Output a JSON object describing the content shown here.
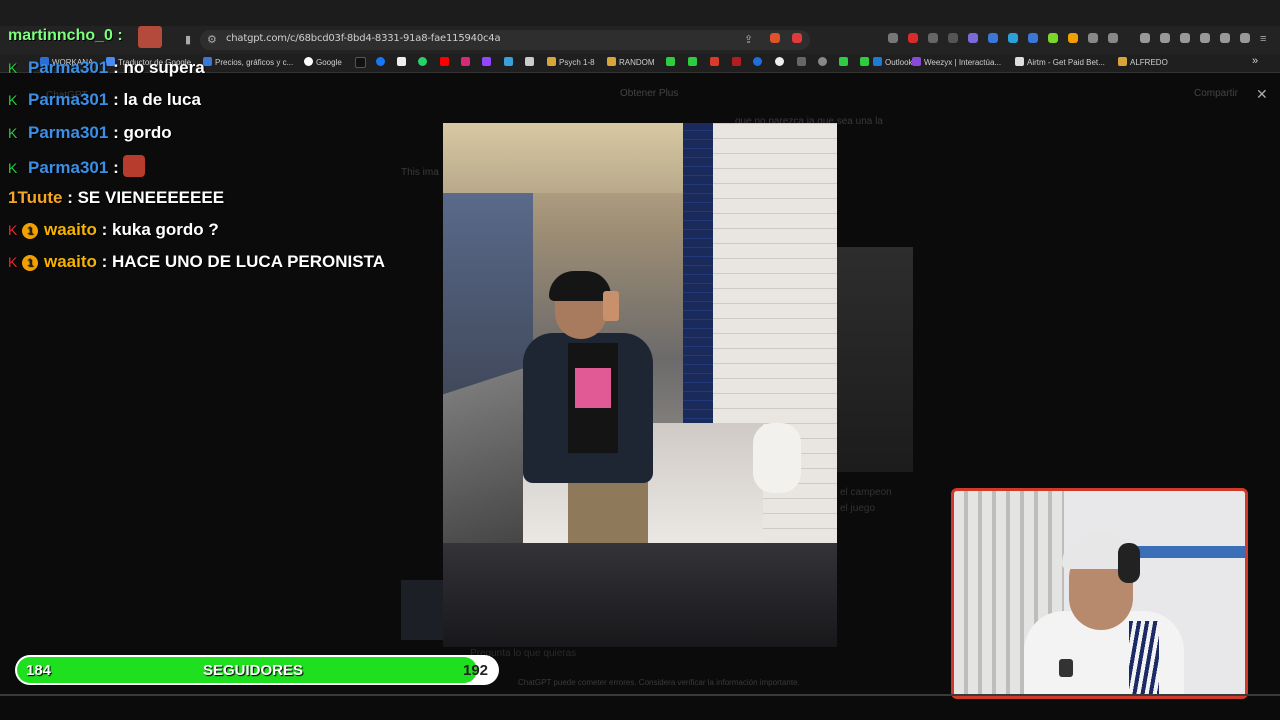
{
  "browser": {
    "url": "chatgpt.com/c/68bcd03f-8bd4-8331-91a8-fae115940c4a",
    "bookmarks": [
      {
        "label": "WORKANA",
        "color": "#2a6fd6"
      },
      {
        "label": "Traductor de Google",
        "color": "#4a8af4"
      },
      {
        "label": "Precios, gráficos y c...",
        "color": "#3a77d8"
      },
      {
        "label": "Google",
        "color": "#ffffff"
      },
      {
        "label": "Psych 1-8",
        "color": "#d9a53a"
      },
      {
        "label": "RANDOM",
        "color": "#d9a53a"
      },
      {
        "label": "Outlook",
        "color": "#1d7bd6"
      },
      {
        "label": "Weezyx | Interactúa...",
        "color": "#8a4ad9"
      },
      {
        "label": "Airtm - Get Paid Bet...",
        "color": "#dddddd"
      },
      {
        "label": "ALFREDO",
        "color": "#d9a53a"
      }
    ]
  },
  "chatgpt_ghost": {
    "title": "ChatGPT",
    "upgrade": "Obtener Plus",
    "share": "Compartir",
    "snippet_right": "que no parezca ia que sea una la",
    "snippet_left": "This ima",
    "snippet_mid": "el campeon",
    "snippet_mid2": "el juego",
    "input_placeholder": "Pregunta lo que quieras",
    "disclaimer": "ChatGPT puede cometer errores. Considera verificar la información importante."
  },
  "chat": {
    "streamer_name": "martinncho_0 :",
    "messages": [
      {
        "user": "Parma301",
        "text": ": no supera",
        "user_color": "blue",
        "badge": "K",
        "emote": false
      },
      {
        "user": "Parma301",
        "text": ": la de luca",
        "user_color": "blue",
        "badge": "K",
        "emote": false
      },
      {
        "user": "Parma301",
        "text": ": gordo",
        "user_color": "blue",
        "badge": "K",
        "emote": false
      },
      {
        "user": "Parma301",
        "text": ":",
        "user_color": "blue",
        "badge": "K",
        "emote": true
      },
      {
        "user": "1Tuute",
        "text": ": SE VIENEEEEEEE",
        "user_color": "orange",
        "badge": "",
        "emote": false
      },
      {
        "user": "waaito",
        "text": ": kuka gordo ?",
        "user_color": "gold",
        "badge": "K",
        "coin": "1",
        "emote": false
      },
      {
        "user": "waaito",
        "text": ": HACE UNO DE LUCA PERONISTA",
        "user_color": "gold",
        "badge": "K",
        "coin": "1",
        "emote": false
      }
    ]
  },
  "followers": {
    "current": "184",
    "label": "SEGUIDORES",
    "goal": "192",
    "progress": 0.958
  },
  "colors": {
    "bar_fill": "#1fe01f",
    "cam_border": "#cf3b28",
    "chat_user_blue": "#3b8fe6"
  }
}
